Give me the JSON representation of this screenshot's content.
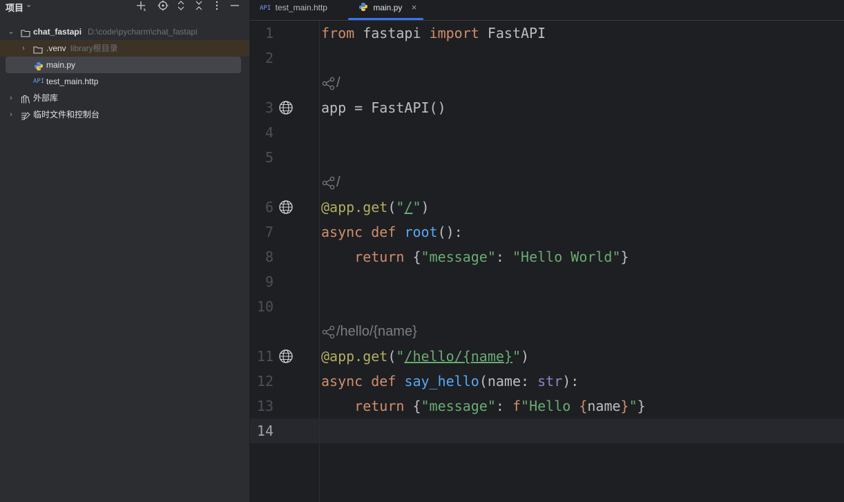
{
  "project_panel": {
    "title": "项目",
    "header_icons": [
      "plus-icon",
      "locate-icon",
      "expand-collapse-icon",
      "collapse-all-icon",
      "more-vertical-icon",
      "minimize-icon"
    ],
    "tree": {
      "root": {
        "name": "chat_fastapi",
        "path": "D:\\code\\pycharm\\chat_fastapi"
      },
      "venv": {
        "name": ".venv",
        "note": "library根目录"
      },
      "main_file": "main.py",
      "http_file": "test_main.http",
      "external_libs": "外部库",
      "scratches": "临时文件和控制台"
    }
  },
  "tabs": [
    {
      "label": "test_main.http",
      "icon": "api-file-icon"
    },
    {
      "label": "main.py",
      "icon": "python-file-icon",
      "active": true,
      "close": "×"
    }
  ],
  "editor": {
    "api_tag": "API",
    "endpoints": {
      "root_app": "/",
      "root_get": "/",
      "hello": "/hello/{name}"
    },
    "line_numbers": [
      "1",
      "2",
      "3",
      "4",
      "5",
      "6",
      "7",
      "8",
      "9",
      "10",
      "11",
      "12",
      "13",
      "14"
    ],
    "current_line": "14",
    "lines": {
      "l1": {
        "k1": "from",
        "m1": " fastapi ",
        "k2": "import",
        "m2": " FastAPI"
      },
      "l3": {
        "t": "app = FastAPI()"
      },
      "l6": {
        "dec": "@app.get",
        "p1": "(",
        "q1": "\"",
        "s": "/",
        "q2": "\"",
        "p2": ")"
      },
      "l7": {
        "k1": "async",
        "k2": "def",
        "fn": "root",
        "rest": "():"
      },
      "l8": {
        "k": "return",
        "b1": " {",
        "s1": "\"message\"",
        "c": ": ",
        "s2": "\"Hello World\"",
        "b2": "}"
      },
      "l11": {
        "dec": "@app.get",
        "p1": "(",
        "q1": "\"",
        "s1": "/hello/",
        "s2": "{name}",
        "q2": "\"",
        "p2": ")"
      },
      "l12": {
        "k1": "async",
        "k2": "def",
        "fn": "say_hello",
        "p1": "(name: ",
        "type": "str",
        "p2": "):"
      },
      "l13": {
        "k": "return",
        "b1": " {",
        "s1": "\"message\"",
        "c": ": ",
        "f": "f",
        "s2": "\"Hello ",
        "o": "{",
        "v": "name",
        "cl": "}",
        "s3": "\"",
        "b2": "}"
      }
    }
  },
  "colors": {
    "keyword": "#cf8e6d",
    "decorator": "#b3ae60",
    "function": "#56a8f5",
    "string": "#6aab73",
    "builtin": "#8888c6",
    "accent": "#3574f0"
  }
}
